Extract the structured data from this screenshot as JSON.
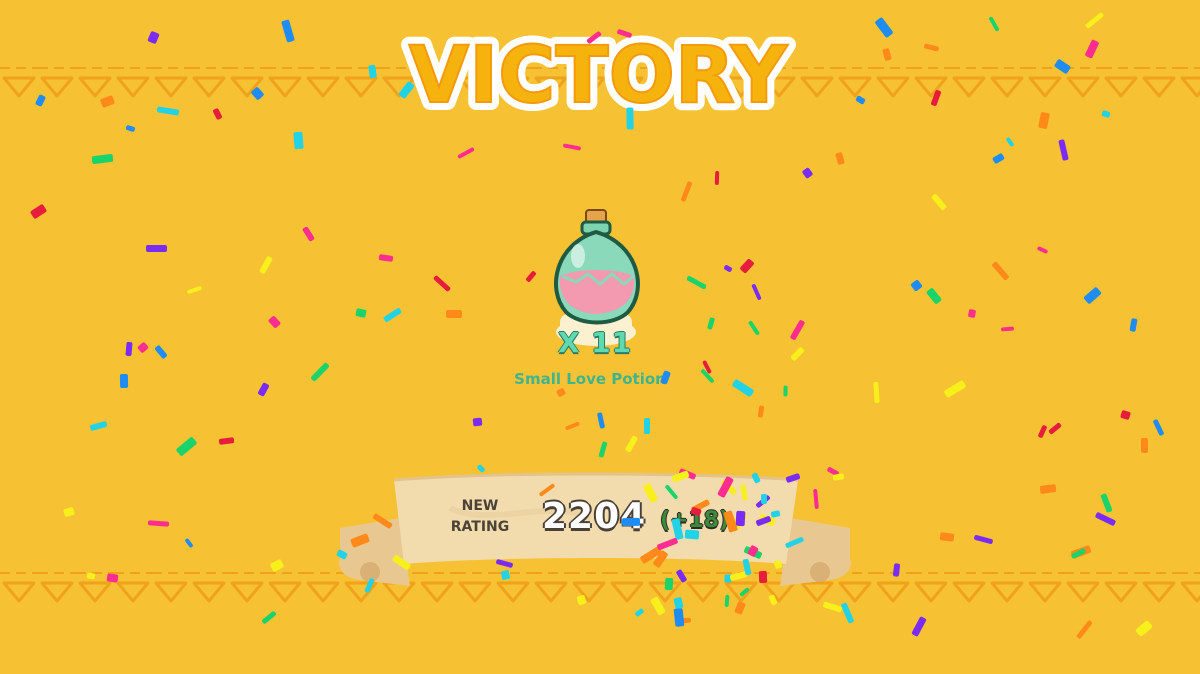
{
  "title": "VICTORY",
  "reward": {
    "icon": "love-potion-icon",
    "quantity": "X 11",
    "name": "Small Love Potion"
  },
  "rating": {
    "label": "NEW\nRATING",
    "value": "2204",
    "change": "(+18)"
  },
  "colors": {
    "background": "#f6c233",
    "band": "#f0a21a",
    "title_fill": "#f7b30d",
    "title_outline": "#ffffff",
    "reward_text": "#3eb58e",
    "scroll": "#f2dcae"
  },
  "confetti_palette": [
    "#ff2d8f",
    "#7a2cf5",
    "#19d36b",
    "#22d3e8",
    "#ff8a1a",
    "#f7f01a",
    "#1f8cf2",
    "#e81c3c"
  ]
}
